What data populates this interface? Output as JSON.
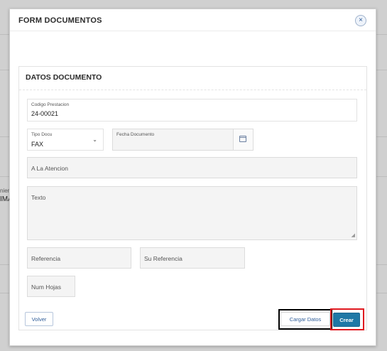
{
  "background": {
    "side_text_1": "nier",
    "side_text_2": "IMA"
  },
  "modal": {
    "title": "FORM DOCUMENTOS",
    "close_label": "×"
  },
  "card": {
    "title": "DATOS DOCUMENTO",
    "codigo_prestacion": {
      "label": "Codigo Prestacion",
      "value": "24-00021"
    },
    "tipo_docu": {
      "label": "Tipo Docu",
      "value": "FAX",
      "chevron": "⌄"
    },
    "fecha_documento": {
      "label": "Fecha Documento",
      "value": ""
    },
    "a_la_atencion": {
      "placeholder": "A La Atencion"
    },
    "texto": {
      "placeholder": "Texto",
      "grip": "◢"
    },
    "referencia": {
      "placeholder": "Referencia"
    },
    "su_referencia": {
      "placeholder": "Su Referencia"
    },
    "num_hojas": {
      "placeholder": "Num Hojas"
    }
  },
  "buttons": {
    "volver": "Volver",
    "cargar_datos": "Cargar Datos",
    "crear": "Crear"
  },
  "colors": {
    "primary": "#1f78a6",
    "highlight_black": "#000000",
    "highlight_red": "#e0191f"
  }
}
